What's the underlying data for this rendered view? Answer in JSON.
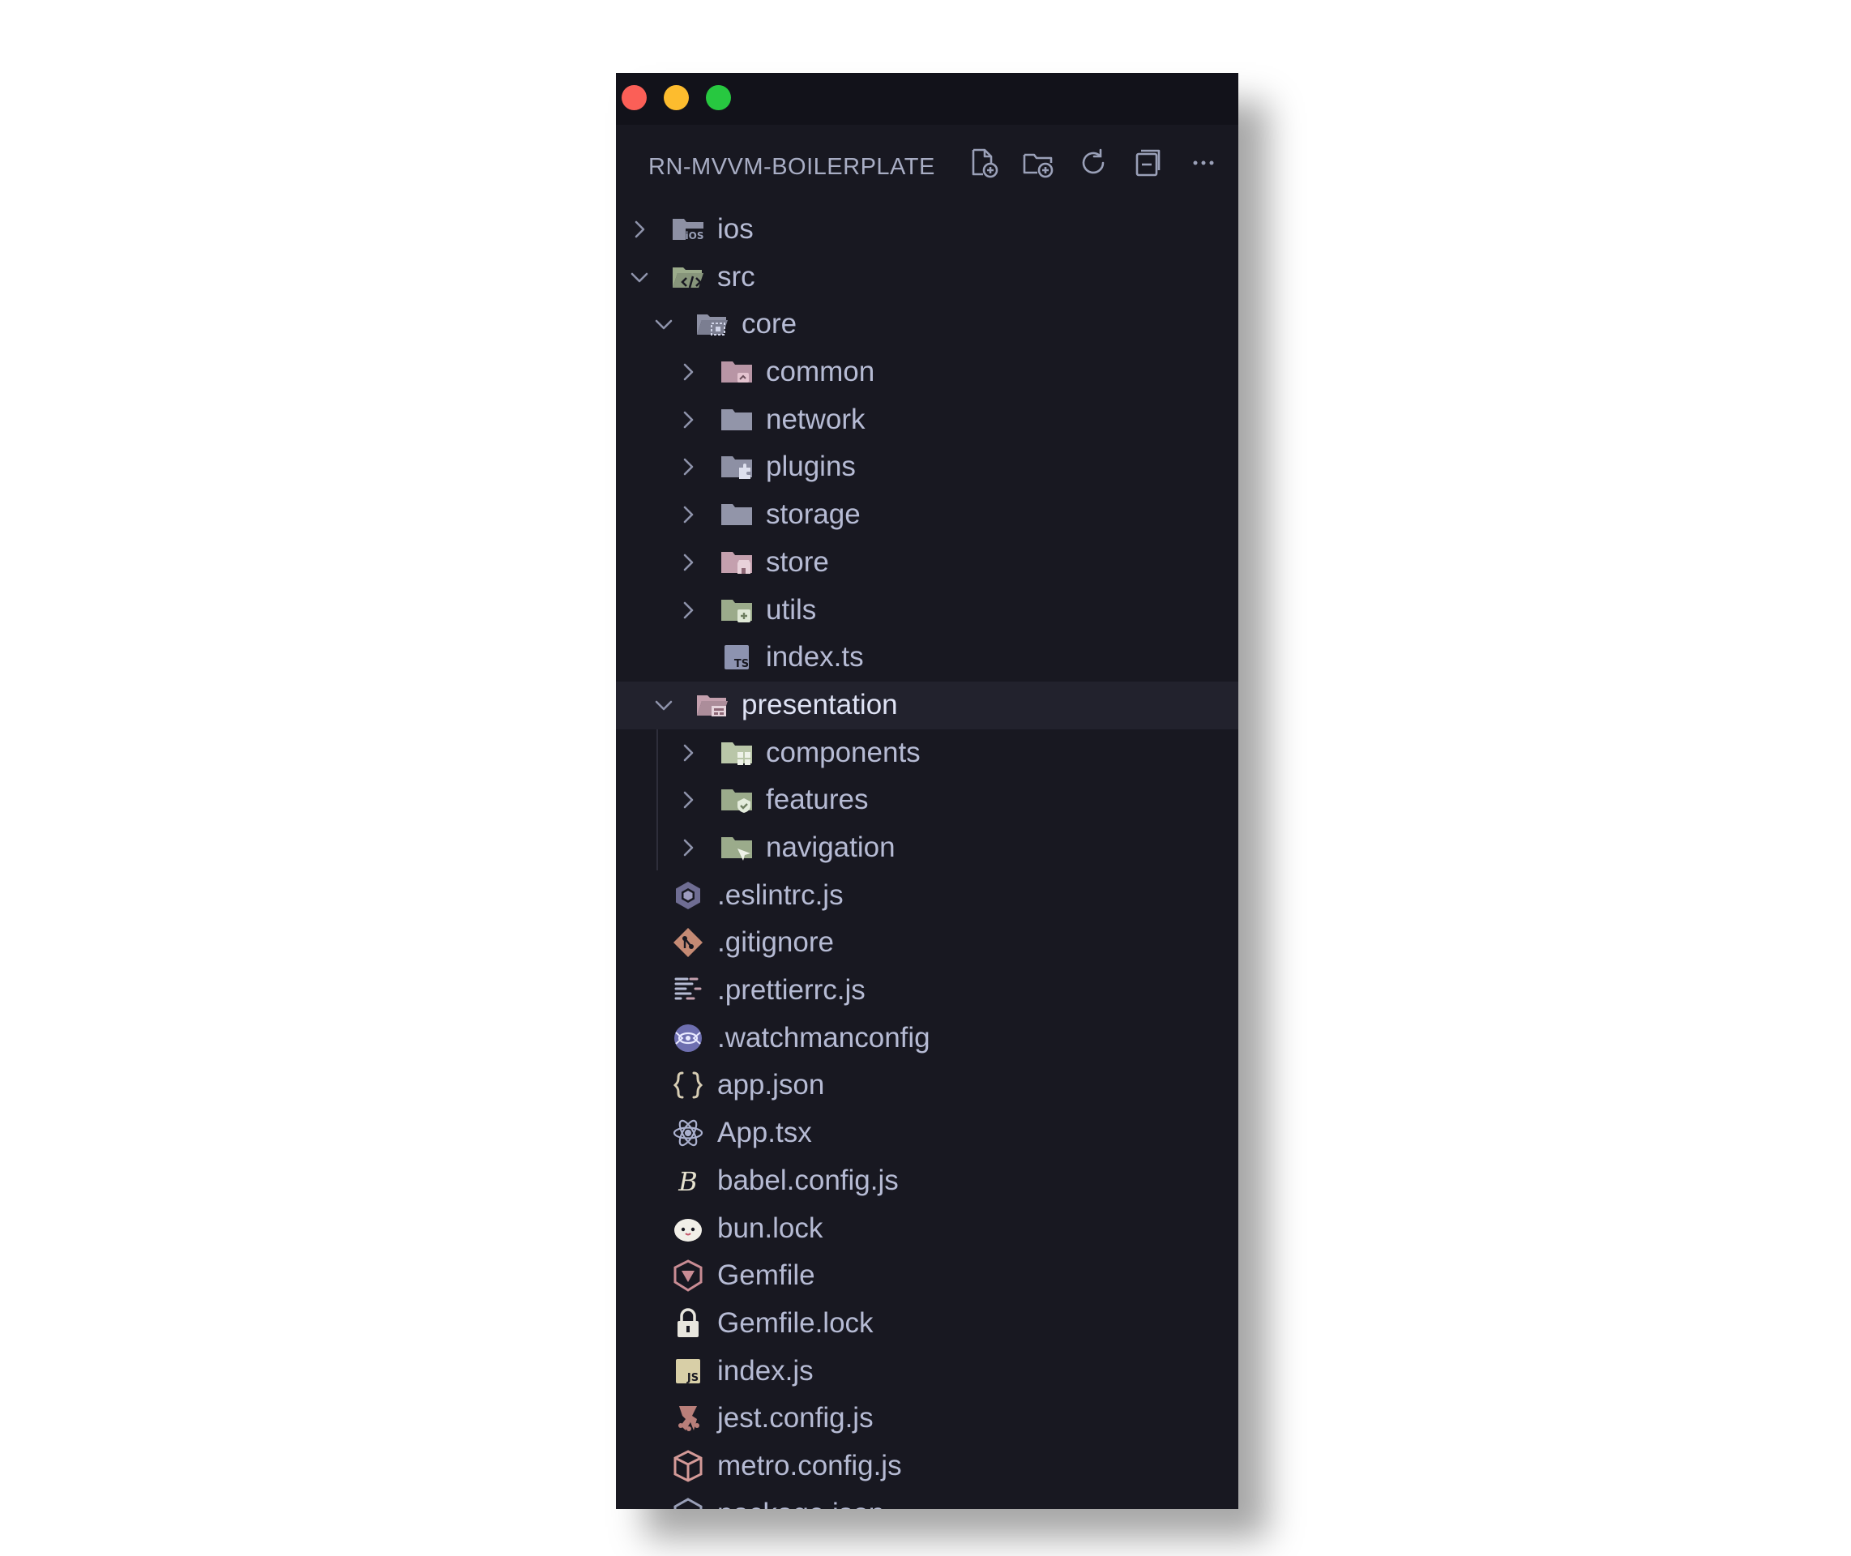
{
  "window": {
    "controls": [
      "close",
      "minimize",
      "zoom"
    ]
  },
  "explorer": {
    "title": "RN-MVVM-BOILERPLATE",
    "actions": [
      {
        "name": "new-file",
        "icon": "new-file-icon"
      },
      {
        "name": "new-folder",
        "icon": "new-folder-icon"
      },
      {
        "name": "refresh",
        "icon": "refresh-icon"
      },
      {
        "name": "collapse-all",
        "icon": "collapse-all-icon"
      },
      {
        "name": "more",
        "icon": "ellipsis-icon"
      }
    ]
  },
  "tree": {
    "items": [
      {
        "label": "ios",
        "type": "folder",
        "expanded": false,
        "depth": 0,
        "icon": "folder-ios-icon"
      },
      {
        "label": "src",
        "type": "folder",
        "expanded": true,
        "depth": 0,
        "icon": "folder-src-icon"
      },
      {
        "label": "core",
        "type": "folder",
        "expanded": true,
        "depth": 1,
        "icon": "folder-core-icon"
      },
      {
        "label": "common",
        "type": "folder",
        "expanded": false,
        "depth": 2,
        "icon": "folder-common-icon"
      },
      {
        "label": "network",
        "type": "folder",
        "expanded": false,
        "depth": 2,
        "icon": "folder-icon"
      },
      {
        "label": "plugins",
        "type": "folder",
        "expanded": false,
        "depth": 2,
        "icon": "folder-plugins-icon"
      },
      {
        "label": "storage",
        "type": "folder",
        "expanded": false,
        "depth": 2,
        "icon": "folder-icon"
      },
      {
        "label": "store",
        "type": "folder",
        "expanded": false,
        "depth": 2,
        "icon": "folder-store-icon"
      },
      {
        "label": "utils",
        "type": "folder",
        "expanded": false,
        "depth": 2,
        "icon": "folder-utils-icon"
      },
      {
        "label": "index.ts",
        "type": "file",
        "depth": 2,
        "icon": "typescript-file-icon"
      },
      {
        "label": "presentation",
        "type": "folder",
        "expanded": true,
        "depth": 1,
        "selected": true,
        "icon": "folder-presentation-icon"
      },
      {
        "label": "components",
        "type": "folder",
        "expanded": false,
        "depth": 2,
        "icon": "folder-components-icon"
      },
      {
        "label": "features",
        "type": "folder",
        "expanded": false,
        "depth": 2,
        "icon": "folder-features-icon"
      },
      {
        "label": "navigation",
        "type": "folder",
        "expanded": false,
        "depth": 2,
        "icon": "folder-navigation-icon"
      },
      {
        "label": ".eslintrc.js",
        "type": "file",
        "depth": 0,
        "icon": "eslint-icon"
      },
      {
        "label": ".gitignore",
        "type": "file",
        "depth": 0,
        "icon": "git-icon"
      },
      {
        "label": ".prettierrc.js",
        "type": "file",
        "depth": 0,
        "icon": "prettier-icon"
      },
      {
        "label": ".watchmanconfig",
        "type": "file",
        "depth": 0,
        "icon": "watchman-icon"
      },
      {
        "label": "app.json",
        "type": "file",
        "depth": 0,
        "icon": "json-icon"
      },
      {
        "label": "App.tsx",
        "type": "file",
        "depth": 0,
        "icon": "react-icon"
      },
      {
        "label": "babel.config.js",
        "type": "file",
        "depth": 0,
        "icon": "babel-icon"
      },
      {
        "label": "bun.lock",
        "type": "file",
        "depth": 0,
        "icon": "bun-icon"
      },
      {
        "label": "Gemfile",
        "type": "file",
        "depth": 0,
        "icon": "ruby-gem-icon"
      },
      {
        "label": "Gemfile.lock",
        "type": "file",
        "depth": 0,
        "icon": "lock-icon"
      },
      {
        "label": "index.js",
        "type": "file",
        "depth": 0,
        "icon": "javascript-file-icon"
      },
      {
        "label": "jest.config.js",
        "type": "file",
        "depth": 0,
        "icon": "jest-icon"
      },
      {
        "label": "metro.config.js",
        "type": "file",
        "depth": 0,
        "icon": "metro-icon"
      },
      {
        "label": "package.json",
        "type": "file",
        "depth": 0,
        "icon": "nodejs-icon"
      }
    ]
  },
  "colors": {
    "background": "#181821",
    "titlebar": "#12121a",
    "selected_row": "#22222d",
    "text": "#b6bbd4",
    "icon_muted": "#8e93ab",
    "folder_grey": "#8d90a4",
    "folder_green": "#9bab8b",
    "folder_pink": "#c4a0ae",
    "close": "#fb5f57",
    "minimize": "#fdbc2e",
    "zoom": "#27c840"
  }
}
